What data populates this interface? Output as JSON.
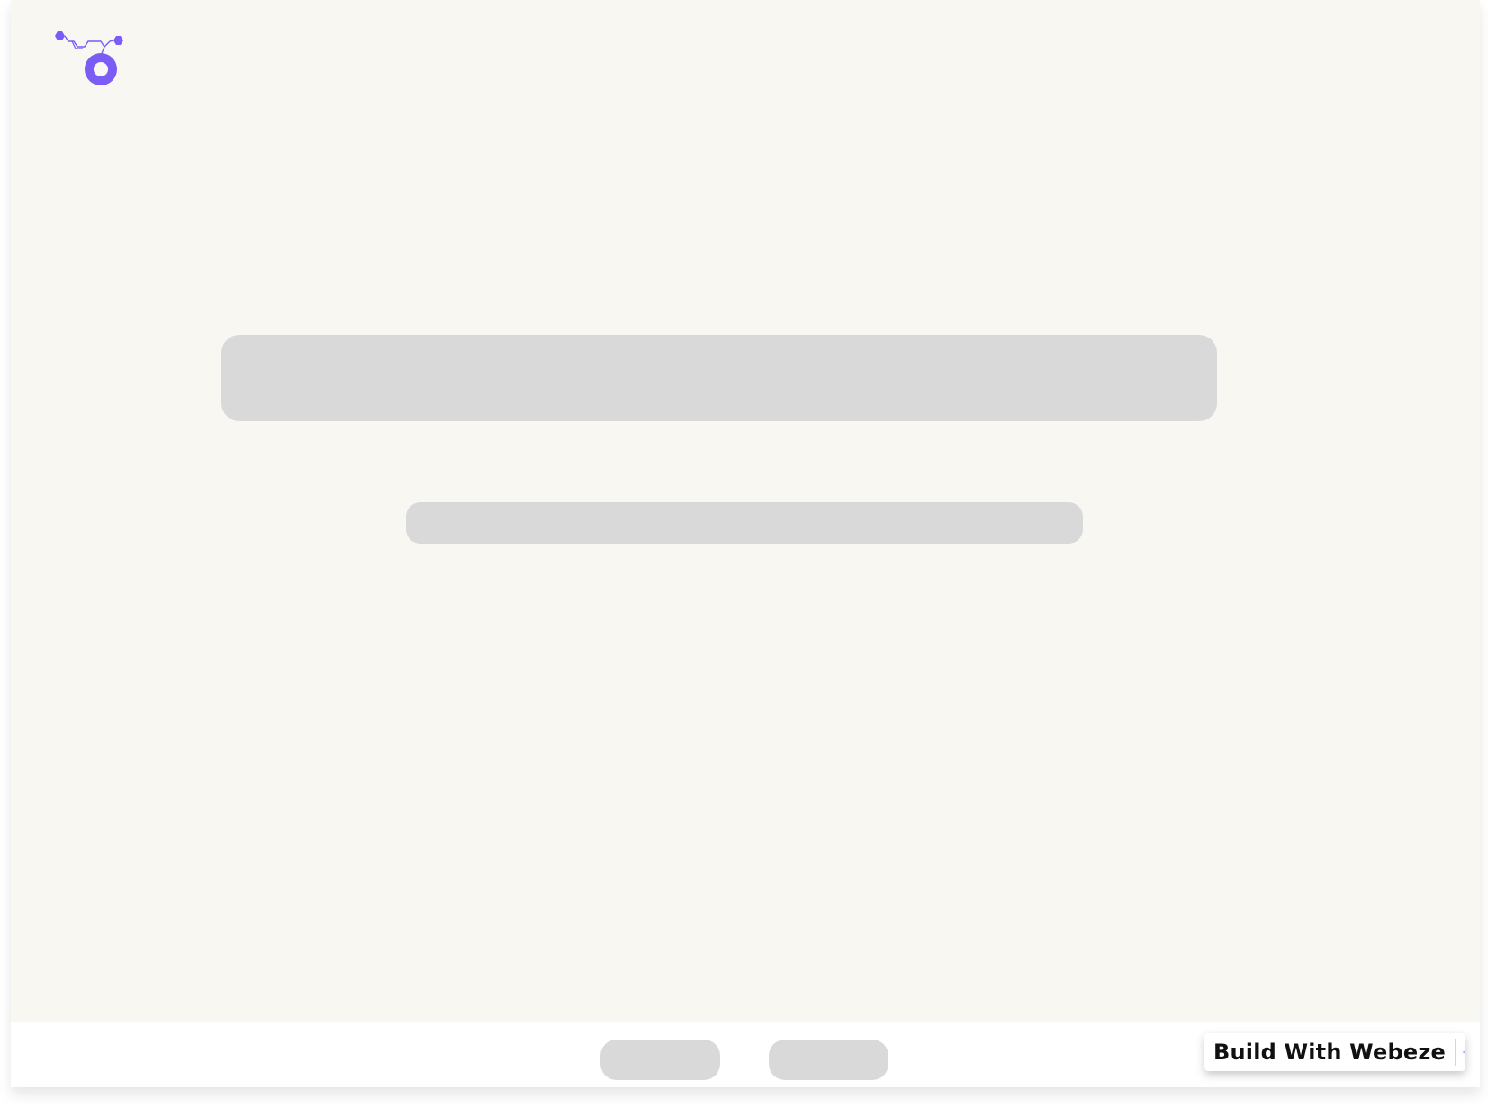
{
  "brand": {
    "logo_icon": "webeze-logo-icon",
    "accent_color": "#7b5cf5"
  },
  "hero": {
    "title_placeholder": "",
    "subtitle_placeholder": ""
  },
  "footer": {
    "buttons": [
      "",
      ""
    ],
    "badge": {
      "label": "Build With Webeze",
      "icon": "webeze-logo-icon"
    }
  },
  "colors": {
    "page_background": "#f8f7f2",
    "skeleton": "#d9d9d9",
    "footer_background": "#ffffff"
  }
}
